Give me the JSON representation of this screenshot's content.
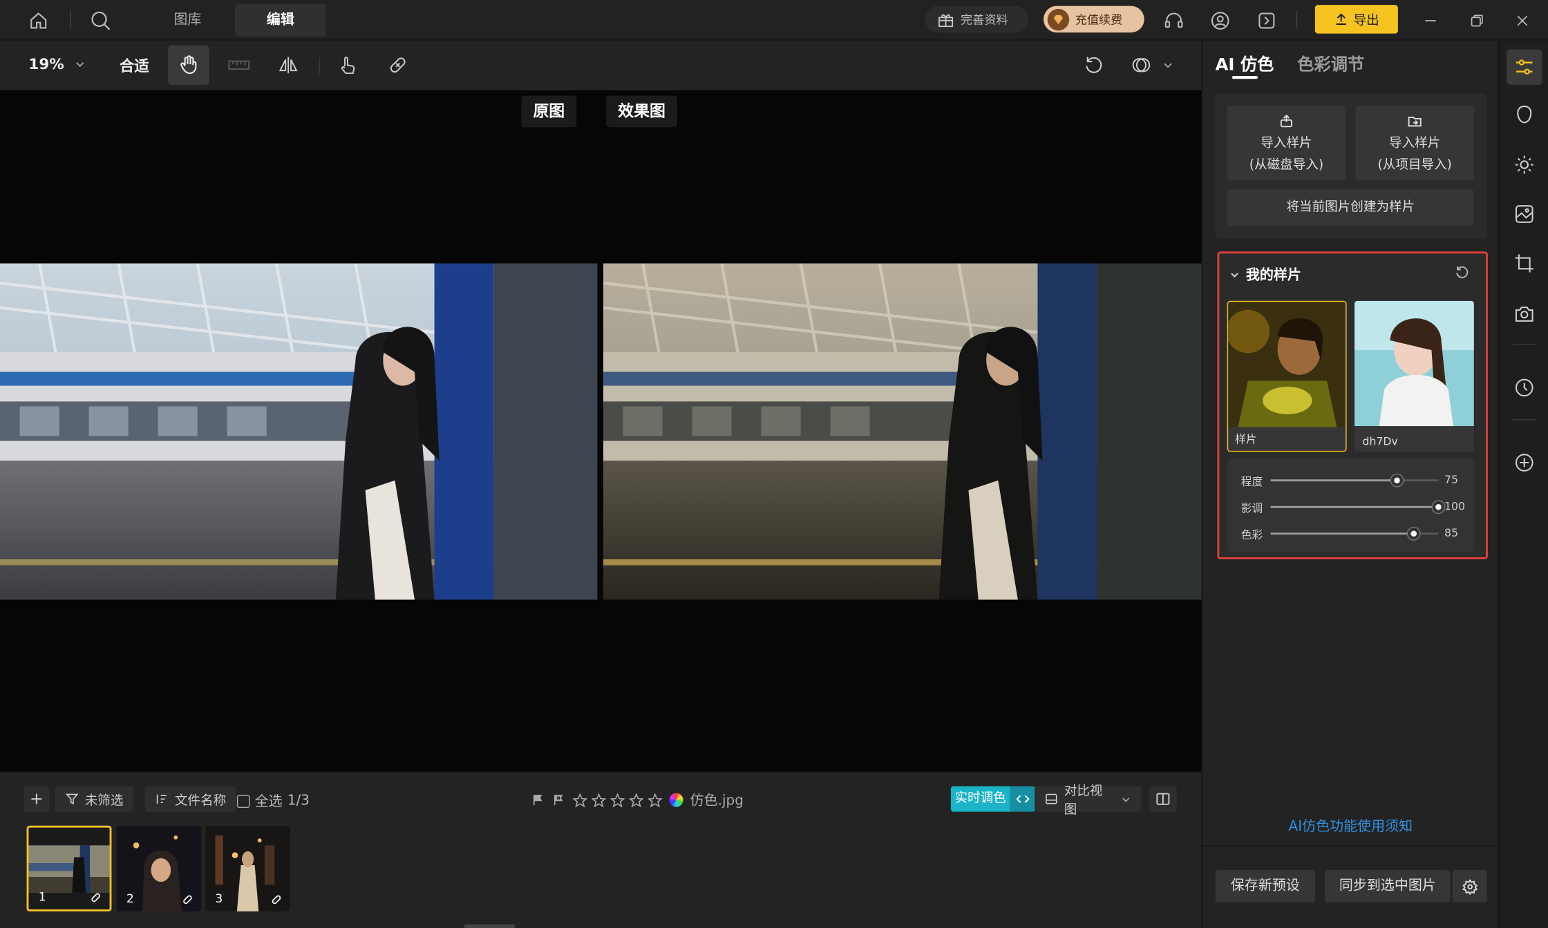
{
  "titlebar": {
    "tabs": [
      {
        "label": "图库"
      },
      {
        "label": "编辑"
      }
    ],
    "complete_profile": "完善资料",
    "recharge": "充值续费",
    "export": "导出"
  },
  "toolbar": {
    "zoom": "19%",
    "fit": "合适"
  },
  "canvas": {
    "original_label": "原图",
    "effect_label": "效果图"
  },
  "bottombar": {
    "filter": "未筛选",
    "sort": "文件名称",
    "select_all": "全选",
    "count": "1/3",
    "rating": 0,
    "filename": "仿色.jpg",
    "realtime": "实时调色",
    "compare_view": "对比视图",
    "thumbs": [
      {
        "num": "1"
      },
      {
        "num": "2"
      },
      {
        "num": "3"
      }
    ]
  },
  "panel": {
    "tab_ai": "AI 仿色",
    "tab_color": "色彩调节",
    "import_disk_1": "导入样片",
    "import_disk_2": "(从磁盘导入)",
    "import_project_1": "导入样片",
    "import_project_2": "(从项目导入)",
    "create_sample": "将当前图片创建为样片",
    "my_samples": "我的样片",
    "samples": [
      {
        "label": "样片"
      },
      {
        "label": "dh7Dv"
      }
    ],
    "sliders": [
      {
        "label": "程度",
        "value": 75,
        "max": 100
      },
      {
        "label": "影调",
        "value": 100,
        "max": 100
      },
      {
        "label": "色彩",
        "value": 85,
        "max": 100
      }
    ],
    "help_link": "AI仿色功能使用须知",
    "save_preset": "保存新预设",
    "sync": "同步到选中图片"
  },
  "colors": {
    "accent_yellow": "#f7c321",
    "highlight_red": "#e0403a",
    "link_blue": "#2f8fe0",
    "realtime_cyan": "#1bb3c8"
  }
}
